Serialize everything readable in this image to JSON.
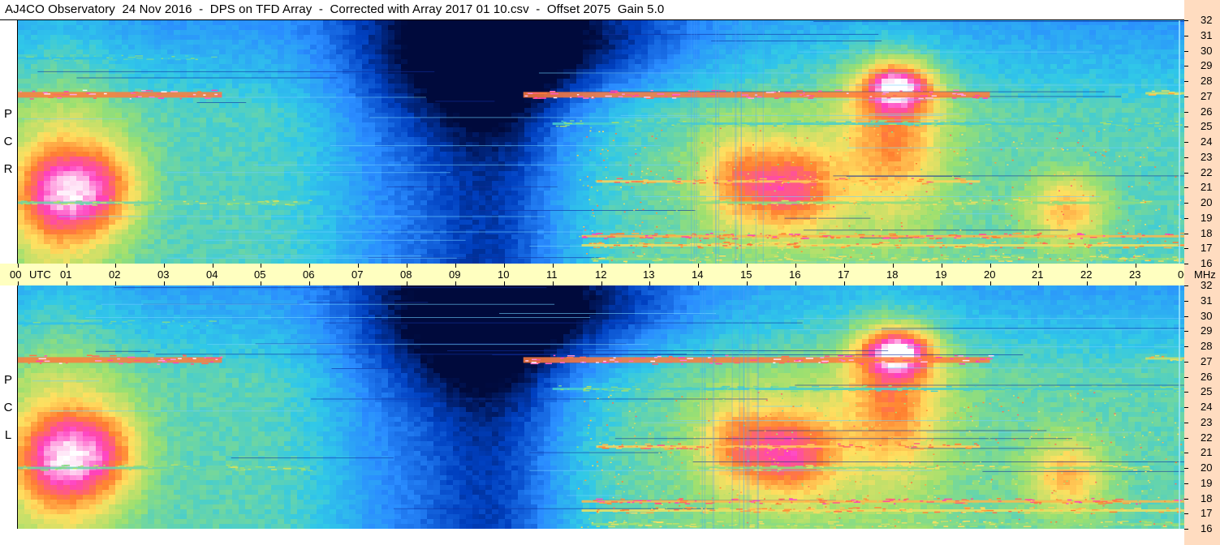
{
  "title": "AJ4CO Observatory  24 Nov 2016  -  DPS on TFD Array  -  Corrected with Array 2017 01 10.csv  -  Offset 2075  Gain 5.0",
  "chart_data": {
    "type": "heatmap",
    "title": "AJ4CO Observatory  24 Nov 2016  -  DPS on TFD Array  -  Corrected with Array 2017 01 10.csv  -  Offset 2075  Gain 5.0",
    "panels": [
      {
        "name": "RCP",
        "label_letters": [
          "R",
          "C",
          "P"
        ]
      },
      {
        "name": "LCP",
        "label_letters": [
          "L",
          "C",
          "P"
        ]
      }
    ],
    "x_axis": {
      "unit": "UTC",
      "range": [
        0,
        24
      ],
      "ticks": [
        "00",
        "01",
        "02",
        "03",
        "04",
        "05",
        "06",
        "07",
        "08",
        "09",
        "10",
        "11",
        "12",
        "13",
        "14",
        "15",
        "16",
        "17",
        "18",
        "19",
        "20",
        "21",
        "22",
        "23",
        "00"
      ]
    },
    "y_axis": {
      "unit": "MHz",
      "range": [
        16,
        32
      ],
      "ticks": [
        "32",
        "31",
        "30",
        "29",
        "28",
        "27",
        "26",
        "25",
        "24",
        "23",
        "22",
        "21",
        "20",
        "19",
        "18",
        "17",
        "16"
      ]
    },
    "colormap": [
      "#000a3c",
      "#0040c0",
      "#2a8cff",
      "#30c8e8",
      "#9be070",
      "#ffe060",
      "#ff8030",
      "#ff40c0",
      "#ffffff"
    ],
    "features": [
      {
        "kind": "band",
        "freq_mhz": 27.1,
        "t_start": 0.0,
        "t_end": 4.2,
        "intensity": 0.95
      },
      {
        "kind": "band",
        "freq_mhz": 27.1,
        "t_start": 10.4,
        "t_end": 20.0,
        "intensity": 0.95
      },
      {
        "kind": "band",
        "freq_mhz": 27.2,
        "t_start": 23.2,
        "t_end": 24.0,
        "intensity": 0.7
      },
      {
        "kind": "band",
        "freq_mhz": 29.5,
        "t_start": 0.0,
        "t_end": 4.0,
        "intensity": 0.45
      },
      {
        "kind": "band",
        "freq_mhz": 17.8,
        "t_start": 11.6,
        "t_end": 24.0,
        "intensity": 0.85
      },
      {
        "kind": "band",
        "freq_mhz": 17.2,
        "t_start": 11.6,
        "t_end": 24.0,
        "intensity": 0.75
      },
      {
        "kind": "band",
        "freq_mhz": 21.4,
        "t_start": 11.9,
        "t_end": 19.8,
        "intensity": 0.8
      },
      {
        "kind": "band",
        "freq_mhz": 20.0,
        "t_start": 0.0,
        "t_end": 6.0,
        "intensity": 0.55
      },
      {
        "kind": "band",
        "freq_mhz": 20.0,
        "t_start": 14.0,
        "t_end": 23.3,
        "intensity": 0.6
      },
      {
        "kind": "band",
        "freq_mhz": 25.2,
        "t_start": 11.0,
        "t_end": 24.0,
        "intensity": 0.5
      },
      {
        "kind": "band",
        "freq_mhz": 16.3,
        "t_start": 11.8,
        "t_end": 24.0,
        "intensity": 0.6
      },
      {
        "kind": "blob",
        "t_center": 0.8,
        "f_center": 20.6,
        "t_width": 0.9,
        "f_width": 3.2,
        "intensity": 0.72
      },
      {
        "kind": "blob",
        "t_center": 1.8,
        "f_center": 21.0,
        "t_width": 0.8,
        "f_width": 3.0,
        "intensity": 0.48
      },
      {
        "kind": "blob",
        "t_center": 16.0,
        "f_center": 21.0,
        "t_width": 0.9,
        "f_width": 2.8,
        "intensity": 0.62
      },
      {
        "kind": "blob",
        "t_center": 14.8,
        "f_center": 21.5,
        "t_width": 0.8,
        "f_width": 3.0,
        "intensity": 0.45
      },
      {
        "kind": "blob",
        "t_center": 18.0,
        "f_center": 24.5,
        "t_width": 1.0,
        "f_width": 5.0,
        "intensity": 0.5
      },
      {
        "kind": "blob",
        "t_center": 18.1,
        "f_center": 27.6,
        "t_width": 0.7,
        "f_width": 1.4,
        "intensity": 0.85
      },
      {
        "kind": "blob",
        "t_center": 21.6,
        "f_center": 19.5,
        "t_width": 0.8,
        "f_width": 2.4,
        "intensity": 0.45
      },
      {
        "kind": "dark",
        "t_center": 9.6,
        "f_center": 29.5,
        "t_width": 2.5,
        "f_width": 5.0,
        "intensity": 0.95
      },
      {
        "kind": "dark",
        "t_center": 12.0,
        "f_center": 30.5,
        "t_width": 2.2,
        "f_width": 3.0,
        "intensity": 0.55
      }
    ]
  }
}
